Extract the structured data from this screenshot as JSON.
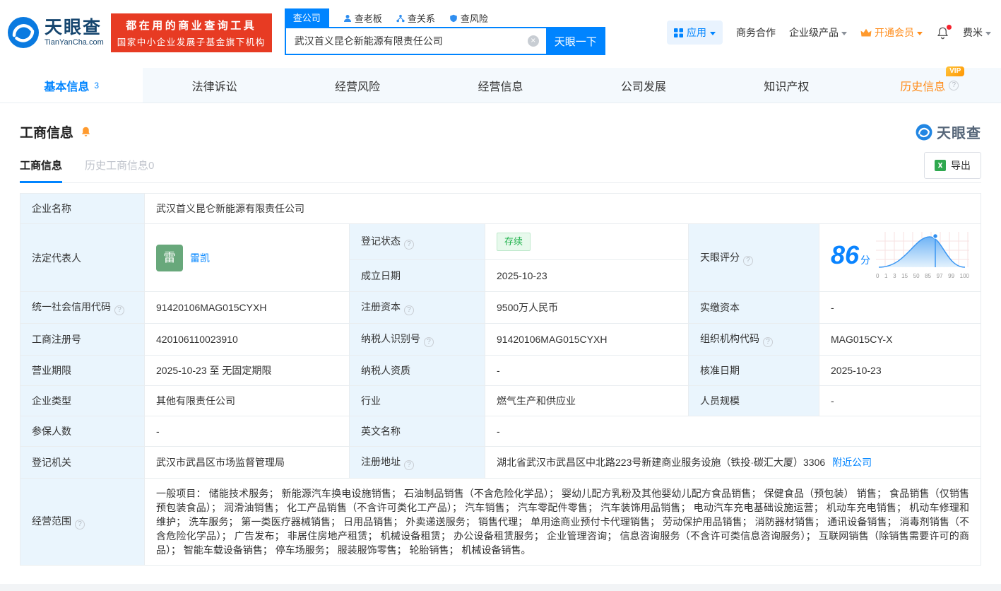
{
  "header": {
    "logo_title": "天眼查",
    "logo_subtitle": "TianYanCha.com",
    "banner_line1": "都在用的商业查询工具",
    "banner_line2": "国家中小企业发展子基金旗下机构",
    "search_tabs": [
      {
        "label": "查公司"
      },
      {
        "label": "查老板"
      },
      {
        "label": "查关系"
      },
      {
        "label": "查风险"
      }
    ],
    "search_value": "武汉首义昆仑新能源有限责任公司",
    "search_button": "天眼一下",
    "apps_label": "应用",
    "link_cooperation": "商务合作",
    "link_enterprise": "企业级产品",
    "link_vip": "开通会员",
    "username": "费米"
  },
  "nav_tabs": [
    {
      "label": "基本信息",
      "badge": "3"
    },
    {
      "label": "法律诉讼"
    },
    {
      "label": "经营风险"
    },
    {
      "label": "经营信息"
    },
    {
      "label": "公司发展"
    },
    {
      "label": "知识产权"
    },
    {
      "label": "历史信息",
      "vip": "VIP"
    }
  ],
  "section": {
    "title": "工商信息",
    "brand": "天眼查",
    "tab_current": "工商信息",
    "tab_history": "历史工商信息0",
    "export_label": "导出"
  },
  "info": {
    "company_name": {
      "label": "企业名称",
      "value": "武汉首义昆仑新能源有限责任公司"
    },
    "legal_rep": {
      "label": "法定代表人",
      "avatar_char": "雷",
      "name": "雷凯"
    },
    "reg_status": {
      "label": "登记状态",
      "value": "存续"
    },
    "establish_date": {
      "label": "成立日期",
      "value": "2025-10-23"
    },
    "score": {
      "label": "天眼评分",
      "value": "86",
      "unit": "分",
      "axis_labels": [
        "0",
        "1",
        "3",
        "15",
        "50",
        "85",
        "97",
        "99",
        "100"
      ]
    },
    "credit_code": {
      "label": "统一社会信用代码",
      "value": "91420106MAG015CYXH"
    },
    "reg_capital": {
      "label": "注册资本",
      "value": "9500万人民币"
    },
    "paid_capital": {
      "label": "实缴资本",
      "value": "-"
    },
    "reg_number": {
      "label": "工商注册号",
      "value": "420106110023910"
    },
    "taxpayer_id": {
      "label": "纳税人识别号",
      "value": "91420106MAG015CYXH"
    },
    "org_code": {
      "label": "组织机构代码",
      "value": "MAG015CY-X"
    },
    "business_term": {
      "label": "营业期限",
      "value": "2025-10-23 至 无固定期限"
    },
    "taxpayer_quality": {
      "label": "纳税人资质",
      "value": "-"
    },
    "approval_date": {
      "label": "核准日期",
      "value": "2025-10-23"
    },
    "company_type": {
      "label": "企业类型",
      "value": "其他有限责任公司"
    },
    "industry": {
      "label": "行业",
      "value": "燃气生产和供应业"
    },
    "staff_size": {
      "label": "人员规模",
      "value": "-"
    },
    "insured_count": {
      "label": "参保人数",
      "value": "-"
    },
    "english_name": {
      "label": "英文名称",
      "value": "-"
    },
    "reg_authority": {
      "label": "登记机关",
      "value": "武汉市武昌区市场监督管理局"
    },
    "reg_address": {
      "label": "注册地址",
      "value": "湖北省武汉市武昌区中北路223号新建商业服务设施（铁投·碳汇大厦）3306",
      "link": "附近公司"
    },
    "business_scope": {
      "label": "经营范围",
      "value": "一般项目： 储能技术服务； 新能源汽车换电设施销售； 石油制品销售（不含危险化学品）； 婴幼儿配方乳粉及其他婴幼儿配方食品销售； 保健食品（预包装） 销售； 食品销售（仅销售预包装食品）； 润滑油销售； 化工产品销售（不含许可类化工产品）； 汽车销售； 汽车零配件零售； 汽车装饰用品销售； 电动汽车充电基础设施运营； 机动车充电销售； 机动车修理和维护； 洗车服务； 第一类医疗器械销售； 日用品销售； 外卖递送服务； 销售代理； 单用途商业预付卡代理销售； 劳动保护用品销售； 消防器材销售； 通讯设备销售； 消毒剂销售（不含危险化学品）； 广告发布； 非居住房地产租赁； 机械设备租赁； 办公设备租赁服务； 企业管理咨询； 信息咨询服务（不含许可类信息咨询服务）； 互联网销售（除销售需要许可的商品）； 智能车载设备销售； 停车场服务； 服装服饰零售； 轮胎销售； 机械设备销售。"
    }
  },
  "colors": {
    "primary_blue": "#0084ff",
    "banner_red": "#e73b23",
    "vip_orange": "#ff8c1a",
    "status_green": "#1fb24c"
  }
}
